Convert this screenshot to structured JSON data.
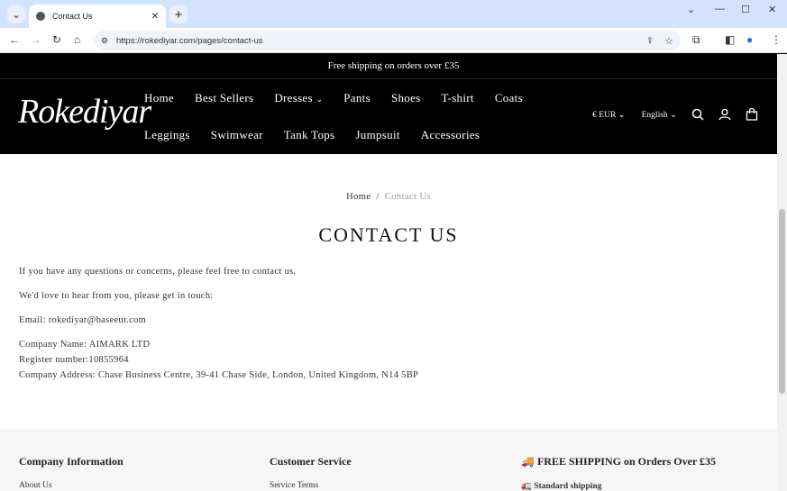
{
  "browser": {
    "tab_title": "Contact Us",
    "url": "https://rokediyar.com/pages/contact-us"
  },
  "announcement": "Free shipping on orders over £35",
  "header": {
    "logo": "Rokediyar",
    "menu_row1": [
      "Home",
      "Best Sellers",
      "Dresses",
      "Pants",
      "Shoes",
      "T-shirt",
      "Coats"
    ],
    "menu_row2": [
      "Leggings",
      "Swimwear",
      "Tank Tops",
      "Jumpsuit",
      "Accessories"
    ],
    "currency": "€ EUR",
    "language": "English"
  },
  "breadcrumb": {
    "home": "Home",
    "sep": "/",
    "current": "Contact Us"
  },
  "page": {
    "title": "CONTACT US",
    "lines": [
      "If you have any questions or concerns, please feel free to contact us.",
      "We'd love to hear from you, please get in touch:",
      "Email: rokediyar@baseeur.com",
      "Company Name: AIMARK LTD",
      "Register number:10855964",
      "Company Address: Chase Business Centre, 39-41 Chase Side, London, United Kingdom, N14 5BP"
    ]
  },
  "footer": {
    "col1_title": "Company Information",
    "col1_link": "About Us",
    "col2_title": "Customer Service",
    "col2_link": "Service Terms",
    "col3_title": "🚚 FREE SHIPPING on Orders Over £35",
    "col3_link": "🚛 Standard shipping"
  }
}
